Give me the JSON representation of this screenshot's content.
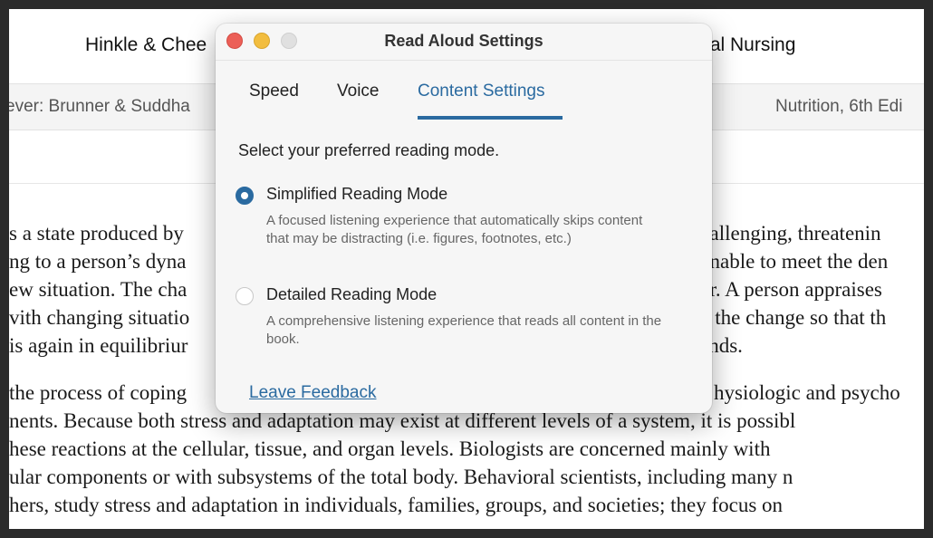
{
  "book": {
    "header_left": "Hinkle & Chee",
    "header_right": "rgical Nursing",
    "tab_left": "ever: Brunner & Suddha",
    "tab_right": "Nutrition, 6th Edi",
    "paragraph1": [
      "s a state produced by",
      "ng to a person’s dyna",
      "ew situation. The cha",
      "vith changing situatio",
      "is again in equilibriur"
    ],
    "paragraph1_right": [
      "hallenging, threatenin",
      "unable to meet the den",
      "or. A person appraises",
      "o the change so that th",
      "ands."
    ],
    "paragraph2": [
      "the process of coping",
      "nents. Because both stress and adaptation may exist at different levels of a system, it is possibl",
      "hese reactions at the cellular, tissue, and organ levels. Biologists are concerned mainly with",
      "ular components or with subsystems of the total body. Behavioral scientists, including many n",
      "hers, study stress and adaptation in individuals, families, groups, and societies; they focus on"
    ],
    "paragraph2_right": [
      "hysiologic and psycho"
    ]
  },
  "modal": {
    "title": "Read Aloud Settings",
    "tabs": [
      "Speed",
      "Voice",
      "Content Settings"
    ],
    "active_tab": "Content Settings",
    "prompt": "Select your preferred reading mode.",
    "options": [
      {
        "label": "Simplified Reading Mode",
        "description": "A focused listening experience that automatically skips content that may be distracting (i.e. figures, footnotes, etc.)",
        "selected": true
      },
      {
        "label": "Detailed Reading Mode",
        "description": "A comprehensive listening experience that reads all content in the book.",
        "selected": false
      }
    ],
    "feedback_link": "Leave Feedback"
  },
  "colors": {
    "accent": "#2a6aa0",
    "close": "#ec5f57",
    "minimize": "#f2bd3f",
    "zoom_disabled": "#e0e0e0"
  }
}
